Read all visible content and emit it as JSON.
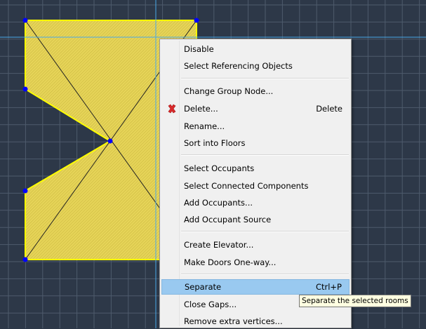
{
  "colors": {
    "canvas_bg": "#2d3848",
    "grid_line": "#4e5b6c",
    "room_fill": "#e4d255",
    "room_outline": "#ffff00",
    "vertex": "#0000ff",
    "guide_line": "#49a8e8",
    "highlight": "#99c9f0"
  },
  "context_menu": {
    "items": [
      {
        "id": "disable",
        "label": "Disable"
      },
      {
        "id": "select-referencing-objects",
        "label": "Select Referencing Objects"
      },
      {
        "id": "change-group-node",
        "label": "Change Group Node..."
      },
      {
        "id": "delete",
        "label": "Delete...",
        "shortcut": "Delete",
        "icon": "delete-x-icon"
      },
      {
        "id": "rename",
        "label": "Rename..."
      },
      {
        "id": "sort-into-floors",
        "label": "Sort into Floors"
      },
      {
        "id": "select-occupants",
        "label": "Select Occupants"
      },
      {
        "id": "select-connected-components",
        "label": "Select Connected Components"
      },
      {
        "id": "add-occupants",
        "label": "Add Occupants..."
      },
      {
        "id": "add-occupant-source",
        "label": "Add Occupant Source"
      },
      {
        "id": "create-elevator",
        "label": "Create Elevator..."
      },
      {
        "id": "make-doors-one-way",
        "label": "Make Doors One-way..."
      },
      {
        "id": "separate",
        "label": "Separate",
        "shortcut": "Ctrl+P",
        "highlighted": true
      },
      {
        "id": "close-gaps",
        "label": "Close Gaps..."
      },
      {
        "id": "remove-extra-vertices",
        "label": "Remove extra vertices..."
      }
    ]
  },
  "tooltip": {
    "text": "Separate the selected rooms"
  }
}
